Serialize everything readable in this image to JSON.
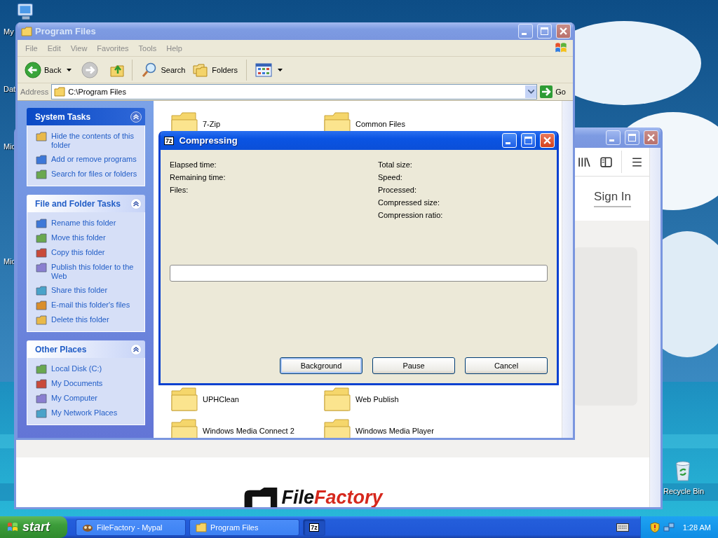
{
  "desktop": {
    "icons": [
      {
        "label": "My"
      },
      {
        "label": "Dat"
      },
      {
        "label": "Mic"
      },
      {
        "label": "Mic"
      }
    ],
    "recycle_bin": {
      "label": "Recycle Bin"
    }
  },
  "browser": {
    "active": false,
    "sign_in": "Sign In",
    "logo": [
      "File",
      "Factory"
    ]
  },
  "explorer": {
    "active": false,
    "title": "Program Files",
    "menu": [
      "File",
      "Edit",
      "View",
      "Favorites",
      "Tools",
      "Help"
    ],
    "toolbar": {
      "back": "Back",
      "search": "Search",
      "folders": "Folders"
    },
    "address": {
      "label": "Address",
      "value": "C:\\Program Files",
      "go": "Go"
    },
    "panels": [
      {
        "title": "System Tasks",
        "kind": "special",
        "items": [
          "Hide the contents of this folder",
          "Add or remove programs",
          "Search for files or folders"
        ]
      },
      {
        "title": "File and Folder Tasks",
        "kind": "normal",
        "items": [
          "Rename this folder",
          "Move this folder",
          "Copy this folder",
          "Publish this folder to the Web",
          "Share this folder",
          "E-mail this folder's files",
          "Delete this folder"
        ]
      },
      {
        "title": "Other Places",
        "kind": "normal",
        "items": [
          "Local Disk (C:)",
          "My Documents",
          "My Computer",
          "My Network Places"
        ]
      }
    ],
    "files": [
      "7-Zip",
      "Common Files",
      "UPHClean",
      "Web Publish",
      "Windows Media Connect 2",
      "Windows Media Player"
    ]
  },
  "dialog": {
    "active": true,
    "icon": "7z",
    "title": "Compressing",
    "left_stats": [
      "Elapsed time:",
      "Remaining time:",
      "Files:"
    ],
    "right_stats": [
      "Total size:",
      "Speed:",
      "Processed:",
      "Compressed size:",
      "Compression ratio:"
    ],
    "progress": {
      "level": 0
    },
    "buttons": [
      {
        "label": "Background",
        "focused": true
      },
      {
        "label": "Pause",
        "focused": false
      },
      {
        "label": "Cancel",
        "focused": false
      }
    ]
  },
  "taskbar": {
    "start": "start",
    "tasks": [
      {
        "label": "FileFactory - Mypal",
        "selected": false
      },
      {
        "label": "Program Files",
        "selected": false
      },
      {
        "label": "7z",
        "selected": true
      }
    ],
    "clock": "1:28 AM"
  }
}
